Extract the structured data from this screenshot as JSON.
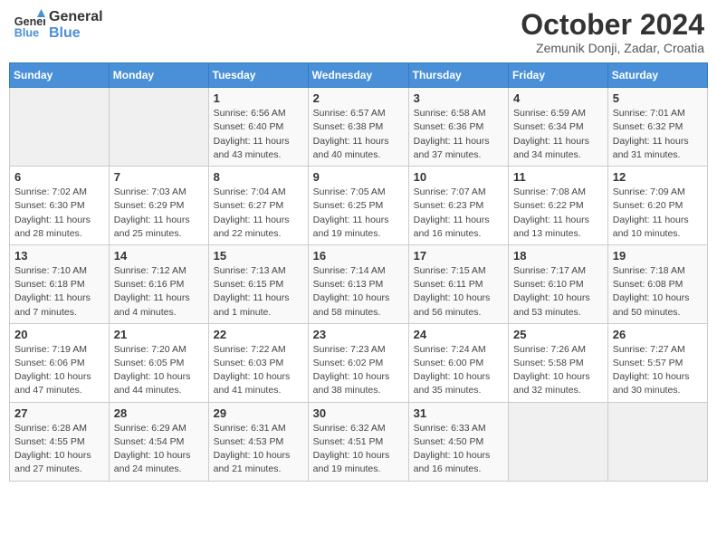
{
  "header": {
    "logo_line1": "General",
    "logo_line2": "Blue",
    "month_title": "October 2024",
    "location": "Zemunik Donji, Zadar, Croatia"
  },
  "days_of_week": [
    "Sunday",
    "Monday",
    "Tuesday",
    "Wednesday",
    "Thursday",
    "Friday",
    "Saturday"
  ],
  "weeks": [
    [
      {
        "day": "",
        "info": ""
      },
      {
        "day": "",
        "info": ""
      },
      {
        "day": "1",
        "info": "Sunrise: 6:56 AM\nSunset: 6:40 PM\nDaylight: 11 hours and 43 minutes."
      },
      {
        "day": "2",
        "info": "Sunrise: 6:57 AM\nSunset: 6:38 PM\nDaylight: 11 hours and 40 minutes."
      },
      {
        "day": "3",
        "info": "Sunrise: 6:58 AM\nSunset: 6:36 PM\nDaylight: 11 hours and 37 minutes."
      },
      {
        "day": "4",
        "info": "Sunrise: 6:59 AM\nSunset: 6:34 PM\nDaylight: 11 hours and 34 minutes."
      },
      {
        "day": "5",
        "info": "Sunrise: 7:01 AM\nSunset: 6:32 PM\nDaylight: 11 hours and 31 minutes."
      }
    ],
    [
      {
        "day": "6",
        "info": "Sunrise: 7:02 AM\nSunset: 6:30 PM\nDaylight: 11 hours and 28 minutes."
      },
      {
        "day": "7",
        "info": "Sunrise: 7:03 AM\nSunset: 6:29 PM\nDaylight: 11 hours and 25 minutes."
      },
      {
        "day": "8",
        "info": "Sunrise: 7:04 AM\nSunset: 6:27 PM\nDaylight: 11 hours and 22 minutes."
      },
      {
        "day": "9",
        "info": "Sunrise: 7:05 AM\nSunset: 6:25 PM\nDaylight: 11 hours and 19 minutes."
      },
      {
        "day": "10",
        "info": "Sunrise: 7:07 AM\nSunset: 6:23 PM\nDaylight: 11 hours and 16 minutes."
      },
      {
        "day": "11",
        "info": "Sunrise: 7:08 AM\nSunset: 6:22 PM\nDaylight: 11 hours and 13 minutes."
      },
      {
        "day": "12",
        "info": "Sunrise: 7:09 AM\nSunset: 6:20 PM\nDaylight: 11 hours and 10 minutes."
      }
    ],
    [
      {
        "day": "13",
        "info": "Sunrise: 7:10 AM\nSunset: 6:18 PM\nDaylight: 11 hours and 7 minutes."
      },
      {
        "day": "14",
        "info": "Sunrise: 7:12 AM\nSunset: 6:16 PM\nDaylight: 11 hours and 4 minutes."
      },
      {
        "day": "15",
        "info": "Sunrise: 7:13 AM\nSunset: 6:15 PM\nDaylight: 11 hours and 1 minute."
      },
      {
        "day": "16",
        "info": "Sunrise: 7:14 AM\nSunset: 6:13 PM\nDaylight: 10 hours and 58 minutes."
      },
      {
        "day": "17",
        "info": "Sunrise: 7:15 AM\nSunset: 6:11 PM\nDaylight: 10 hours and 56 minutes."
      },
      {
        "day": "18",
        "info": "Sunrise: 7:17 AM\nSunset: 6:10 PM\nDaylight: 10 hours and 53 minutes."
      },
      {
        "day": "19",
        "info": "Sunrise: 7:18 AM\nSunset: 6:08 PM\nDaylight: 10 hours and 50 minutes."
      }
    ],
    [
      {
        "day": "20",
        "info": "Sunrise: 7:19 AM\nSunset: 6:06 PM\nDaylight: 10 hours and 47 minutes."
      },
      {
        "day": "21",
        "info": "Sunrise: 7:20 AM\nSunset: 6:05 PM\nDaylight: 10 hours and 44 minutes."
      },
      {
        "day": "22",
        "info": "Sunrise: 7:22 AM\nSunset: 6:03 PM\nDaylight: 10 hours and 41 minutes."
      },
      {
        "day": "23",
        "info": "Sunrise: 7:23 AM\nSunset: 6:02 PM\nDaylight: 10 hours and 38 minutes."
      },
      {
        "day": "24",
        "info": "Sunrise: 7:24 AM\nSunset: 6:00 PM\nDaylight: 10 hours and 35 minutes."
      },
      {
        "day": "25",
        "info": "Sunrise: 7:26 AM\nSunset: 5:58 PM\nDaylight: 10 hours and 32 minutes."
      },
      {
        "day": "26",
        "info": "Sunrise: 7:27 AM\nSunset: 5:57 PM\nDaylight: 10 hours and 30 minutes."
      }
    ],
    [
      {
        "day": "27",
        "info": "Sunrise: 6:28 AM\nSunset: 4:55 PM\nDaylight: 10 hours and 27 minutes."
      },
      {
        "day": "28",
        "info": "Sunrise: 6:29 AM\nSunset: 4:54 PM\nDaylight: 10 hours and 24 minutes."
      },
      {
        "day": "29",
        "info": "Sunrise: 6:31 AM\nSunset: 4:53 PM\nDaylight: 10 hours and 21 minutes."
      },
      {
        "day": "30",
        "info": "Sunrise: 6:32 AM\nSunset: 4:51 PM\nDaylight: 10 hours and 19 minutes."
      },
      {
        "day": "31",
        "info": "Sunrise: 6:33 AM\nSunset: 4:50 PM\nDaylight: 10 hours and 16 minutes."
      },
      {
        "day": "",
        "info": ""
      },
      {
        "day": "",
        "info": ""
      }
    ]
  ]
}
